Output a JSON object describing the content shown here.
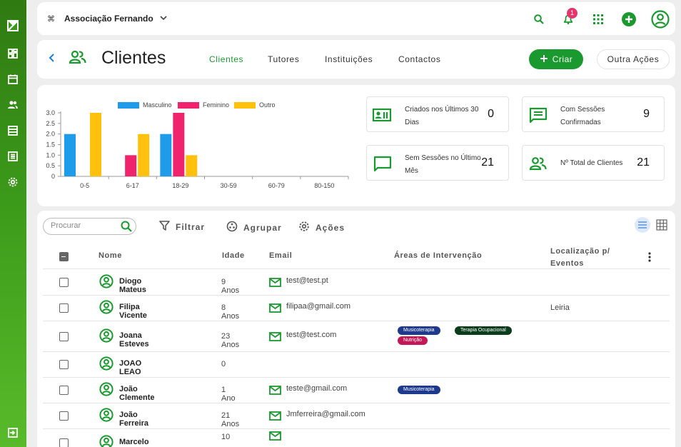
{
  "colors": {
    "brand_green": "#1a9a2e",
    "male": "#1e9be9",
    "female": "#f0246c",
    "other": "#fec20e"
  },
  "sidebar": {
    "icons": [
      "brand-logo-icon",
      "dashboard-icon",
      "calendar-icon",
      "users-icon",
      "list-icon",
      "report-icon",
      "settings-icon",
      "logout-icon"
    ]
  },
  "topbar": {
    "org_name": "Associação Fernando",
    "notification_count": "1"
  },
  "header": {
    "title": "Clientes",
    "tabs": [
      "Clientes",
      "Tutores",
      "Instituições",
      "Contactos"
    ],
    "active_tab": "Clientes",
    "create_label": "Criar",
    "other_actions_label": "Outra Ações"
  },
  "stats": [
    {
      "label": "Criados nos Últimos 30 Dias",
      "value": "0",
      "icon": "contact-card-icon"
    },
    {
      "label": "Com Sessões Confirmadas",
      "value": "9",
      "icon": "message-icon"
    },
    {
      "label": "Sem Sessões no Último Mês",
      "value": "21",
      "icon": "chat-bubble-icon"
    },
    {
      "label": "Nº Total de Clientes",
      "value": "21",
      "icon": "users-icon"
    }
  ],
  "chart_data": {
    "type": "bar",
    "categories": [
      "0-5",
      "6-17",
      "18-29",
      "30-59",
      "60-79",
      "80-150"
    ],
    "series": [
      {
        "name": "Masculino",
        "color": "#1e9be9",
        "values": [
          2,
          0,
          2,
          0,
          0,
          0
        ]
      },
      {
        "name": "Feminino",
        "color": "#f0246c",
        "values": [
          0,
          1,
          3,
          0,
          0,
          0
        ]
      },
      {
        "name": "Outro",
        "color": "#fec20e",
        "values": [
          3,
          2,
          1,
          0,
          0,
          0
        ]
      }
    ],
    "yticks": [
      "0",
      "0.5",
      "1.0",
      "1.5",
      "2.0",
      "2.5",
      "3.0"
    ],
    "ylim": [
      0,
      3
    ],
    "legend": "top",
    "grid": false
  },
  "toolbar": {
    "search_placeholder": "Procurar",
    "filter_label": "Filtrar",
    "group_label": "Agrupar",
    "actions_label": "Ações"
  },
  "table": {
    "headers": [
      "Nome",
      "Idade",
      "Email",
      "Áreas de Intervenção",
      "Localização p/ Eventos"
    ],
    "header_loc_line1": "Localização p/",
    "header_loc_line2": "Eventos",
    "rows": [
      {
        "name": "Diogo Mateus",
        "age": "9 Anos",
        "email": "test@test.pt",
        "areas": [],
        "location": ""
      },
      {
        "name": "Filipa Vicente",
        "age": "8 Anos",
        "email": "filipaa@gmail.com",
        "areas": [],
        "location": "Leiria"
      },
      {
        "name": "Joana Esteves",
        "age": "23 Anos",
        "email": "test@test.com",
        "areas": [
          {
            "label": "Musicoterapia",
            "color": "#1e3a8f"
          },
          {
            "label": "Terapia Ocupacional",
            "color": "#0b3d1c"
          },
          {
            "label": "Nutrição",
            "color": "#c21858"
          }
        ],
        "location": ""
      },
      {
        "name": "JOAO LEAO",
        "age": "0",
        "email": "",
        "areas": [],
        "location": ""
      },
      {
        "name": "João Clemente",
        "age": "1 Ano",
        "email": "teste@gmail.com",
        "areas": [
          {
            "label": "Musicoterapia",
            "color": "#1e3a8f"
          }
        ],
        "location": ""
      },
      {
        "name": "João Ferreira",
        "age": "21 Anos",
        "email": "Jmferreira@gmail.com",
        "areas": [],
        "location": ""
      },
      {
        "name": "Marcelo Pereira",
        "age": "10",
        "email": "",
        "areas": [],
        "location": ""
      }
    ]
  }
}
